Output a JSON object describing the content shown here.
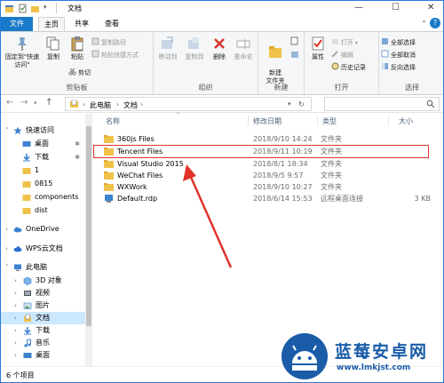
{
  "window": {
    "title": "文档",
    "controls": {
      "minimize": "—",
      "maximize": "☐",
      "close": "✕"
    }
  },
  "tabs": {
    "file": "文件",
    "home": "主页",
    "share": "共享",
    "view": "查看"
  },
  "ribbon": {
    "clipboard": {
      "label": "剪贴板",
      "pin": "固定到\"快速访问\"",
      "copy": "复制",
      "paste": "粘贴",
      "copy_path": "复制路径",
      "paste_shortcut": "粘贴快捷方式",
      "cut": "剪切"
    },
    "organize": {
      "label": "组织",
      "move_to": "移动到",
      "copy_to": "复制到",
      "delete": "删除",
      "rename": "重命名"
    },
    "new": {
      "label": "新建",
      "new_folder": "新建\n文件夹"
    },
    "open": {
      "label": "打开",
      "properties": "属性",
      "open": "打开",
      "edit": "编辑",
      "history": "历史记录"
    },
    "select": {
      "label": "选择",
      "select_all": "全部选择",
      "select_none": "全部取消",
      "invert": "反向选择"
    }
  },
  "address": {
    "path": [
      "此电脑",
      "文档"
    ],
    "search_placeholder": ""
  },
  "nav": {
    "quick_access": "快速访问",
    "items": [
      {
        "label": "桌面",
        "pinned": true
      },
      {
        "label": "下载",
        "pinned": true
      },
      {
        "label": "1"
      },
      {
        "label": "0815"
      },
      {
        "label": "components"
      },
      {
        "label": "dist"
      }
    ],
    "onedrive": "OneDrive",
    "wps": "WPS云文档",
    "this_pc": "此电脑",
    "pc_items": [
      "3D 对象",
      "视频",
      "图片",
      "文档",
      "下载",
      "音乐",
      "桌面"
    ]
  },
  "columns": {
    "name": "名称",
    "modified": "修改日期",
    "type": "类型",
    "size": "大小"
  },
  "files": [
    {
      "name": "360js Files",
      "modified": "2018/9/10 14:24",
      "type": "文件夹",
      "size": "",
      "kind": "folder"
    },
    {
      "name": "Tencent Files",
      "modified": "2018/9/11 10:19",
      "type": "文件夹",
      "size": "",
      "kind": "folder"
    },
    {
      "name": "Visual Studio 2015",
      "modified": "2018/8/1 18:34",
      "type": "文件夹",
      "size": "",
      "kind": "folder"
    },
    {
      "name": "WeChat Files",
      "modified": "2018/9/5 9:57",
      "type": "文件夹",
      "size": "",
      "kind": "folder"
    },
    {
      "name": "WXWork",
      "modified": "2018/9/10 10:27",
      "type": "文件夹",
      "size": "",
      "kind": "folder"
    },
    {
      "name": "Default.rdp",
      "modified": "2018/6/14 15:53",
      "type": "远程桌面连接",
      "size": "3 KB",
      "kind": "rdp"
    }
  ],
  "status": {
    "count": "6 个项目"
  },
  "watermark": {
    "title": "蓝莓安卓网",
    "url": "www.lmkjst.com"
  },
  "colors": {
    "accent": "#1979ca",
    "highlight": "#e0342b",
    "folder": "#f0c24a"
  }
}
